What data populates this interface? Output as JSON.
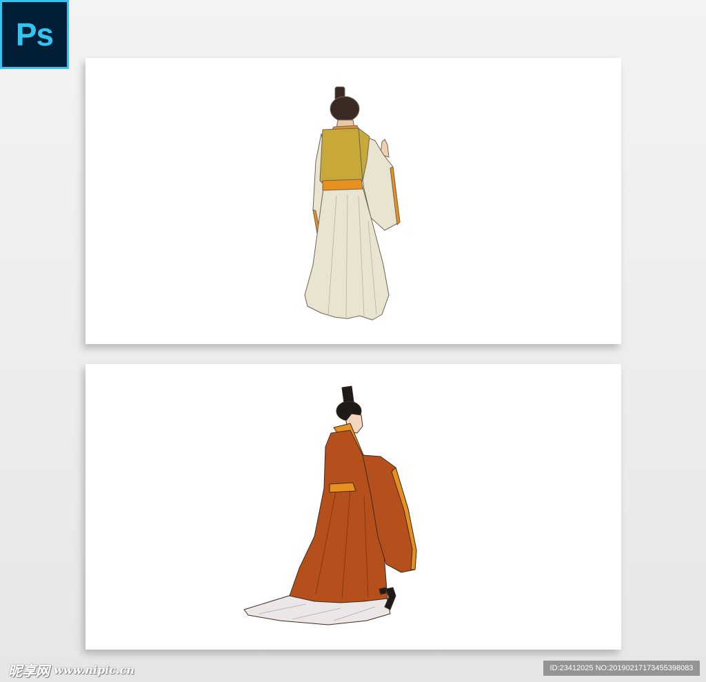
{
  "app": {
    "logo_text": "Ps",
    "logo_colors": {
      "background": "#001e36",
      "accent": "#31c5f0"
    }
  },
  "cards": [
    {
      "figure": "standing-figure-back-view-icon",
      "colors": {
        "robe": "#e8e4cf",
        "vest": "#c9a83a",
        "trim": "#e8901e",
        "hair": "#3a2a22"
      }
    },
    {
      "figure": "walking-figure-side-view-icon",
      "colors": {
        "robe": "#b5501d",
        "trim": "#e8901e",
        "underskirt": "#ece6e6",
        "hair": "#1e1a18"
      }
    }
  ],
  "watermark": {
    "brand": "昵享网",
    "url": "www.nipic.cn",
    "id_text": "ID:23412025 NO:20190217173455398083"
  }
}
